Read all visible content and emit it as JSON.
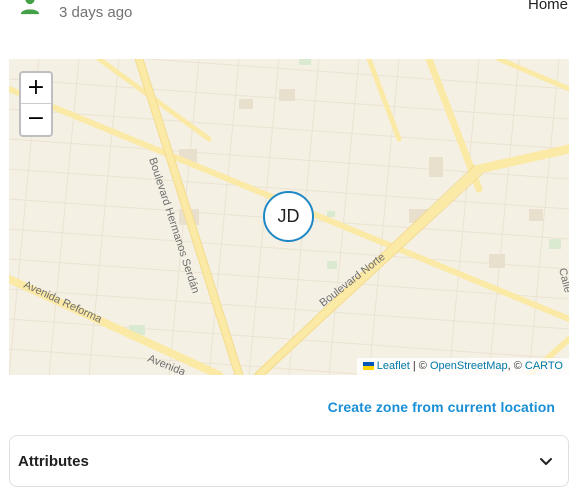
{
  "header": {
    "last_changed": "3 days ago",
    "state": "Home",
    "person_icon": "account-icon"
  },
  "map": {
    "zoom_in_label": "+",
    "zoom_out_label": "−",
    "marker_initials": "JD",
    "street_labels": {
      "boulevard_hermanos_serdan": "Boulevard Hermanos Serdán",
      "boulevard_norte": "Boulevard Norte",
      "avenida_reforma": "Avenida Reforma",
      "avenida_2": "Avenida",
      "calle": "Calle"
    },
    "attribution": {
      "leaflet": "Leaflet",
      "separator": " | © ",
      "osm": "OpenStreetMap",
      "comma": ", © ",
      "carto": "CARTO"
    }
  },
  "actions": {
    "create_zone": "Create zone from current location"
  },
  "attributes": {
    "label": "Attributes",
    "chevron_icon": "chevron-down-icon"
  },
  "colors": {
    "accent": "#1a8fd6",
    "person_green": "#43a047",
    "map_background": "#f5f0e4",
    "road": "#fbe9a6",
    "marker_border": "#1e88c7"
  }
}
